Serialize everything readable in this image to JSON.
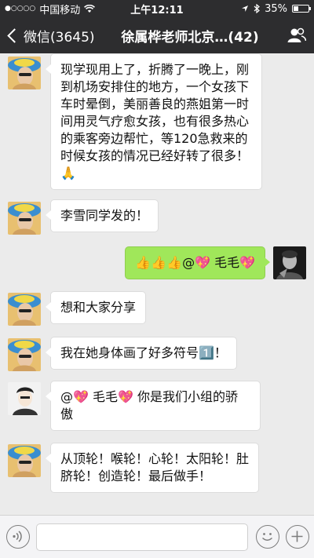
{
  "status_bar": {
    "signal": "●○○○○",
    "carrier": "中国移动",
    "time": "上午12:11",
    "battery": "35%",
    "battery_level": 0.35
  },
  "nav": {
    "back_label": "微信(3645)",
    "title": "徐属桦老师北京…(42)"
  },
  "messages": [
    {
      "side": "left",
      "text": "现学现用上了，折腾了一晚上，刚到机场安排住的地方，一个女孩下车时晕倒，美丽善良的燕姐第一时间用灵气疗愈女孩，也有很多热心的乘客旁边帮忙，等120急救来的时候女孩的情况已经好转了很多！🙏"
    },
    {
      "side": "left",
      "text": "李雪同学发的！"
    },
    {
      "side": "right",
      "text": "👍👍👍@💖 毛毛💖"
    },
    {
      "side": "left",
      "text": "想和大家分享"
    },
    {
      "side": "left",
      "text": "我在她身体画了好多符号1️⃣！"
    },
    {
      "side": "left",
      "text": "@💖 毛毛💖  你是我们小组的骄傲"
    },
    {
      "side": "left",
      "text": "从顶轮！喉轮！心轮！太阳轮！肚脐轮！创造轮！最后做手！"
    }
  ],
  "input": {
    "value": ""
  }
}
